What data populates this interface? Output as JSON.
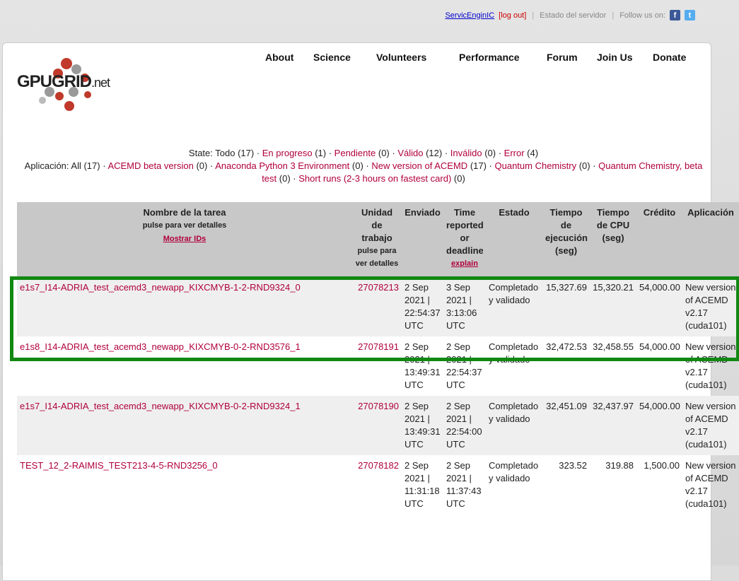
{
  "topbar": {
    "user": "ServicEnginIC",
    "logout": "[log out]",
    "server_status": "Estado del servidor",
    "follow": "Follow us on:",
    "facebook_icon": "f",
    "twitter_icon": "t"
  },
  "logo": {
    "main": "GPUGRID",
    "suffix": ".net"
  },
  "nav": [
    "About",
    "Science",
    "Volunteers",
    "Performance",
    "Forum",
    "Join Us",
    "Donate"
  ],
  "filters": {
    "state_label": "State: Todo (17) ·",
    "states": [
      {
        "label": "En progreso",
        "count": "(1)"
      },
      {
        "label": "Pendiente",
        "count": "(0)"
      },
      {
        "label": "Válido",
        "count": "(12)"
      },
      {
        "label": "Inválido",
        "count": "(0)"
      },
      {
        "label": "Error",
        "count": "(4)"
      }
    ],
    "app_label": "Aplicación: All (17) ·",
    "apps": [
      {
        "label": "ACEMD beta version",
        "count": "(0)"
      },
      {
        "label": "Anaconda Python 3 Environment",
        "count": "(0)"
      },
      {
        "label": "New version of ACEMD",
        "count": "(17)"
      },
      {
        "label": "Quantum Chemistry",
        "count": "(0)"
      },
      {
        "label": "Quantum Chemistry, beta test",
        "count": "(0)"
      },
      {
        "label": "Short runs (2-3 hours on fastest card)",
        "count": "(0)"
      }
    ]
  },
  "table": {
    "headers": {
      "name": "Nombre de la tarea",
      "name_sub": "pulse para ver detalles",
      "name_link": "Mostrar IDs",
      "unit": "Unidad de trabajo",
      "unit_sub": "pulse para ver detalles",
      "sent": "Enviado",
      "time": "Time reported or deadline",
      "time_link": "explain",
      "state": "Estado",
      "runtime": "Tiempo de ejecución (seg)",
      "cputime": "Tiempo de CPU (seg)",
      "credit": "Crédito",
      "app": "Aplicación"
    },
    "rows": [
      {
        "name": "e1s7_I14-ADRIA_test_acemd3_newapp_KIXCMYB-1-2-RND9324_0",
        "unit": "27078213",
        "sent": "2 Sep 2021 | 22:54:37 UTC",
        "time": "3 Sep 2021 | 3:13:06 UTC",
        "state": "Completado y validado",
        "runtime": "15,327.69",
        "cputime": "15,320.21",
        "credit": "54,000.00",
        "app": "New version of ACEMD v2.17 (cuda101)"
      },
      {
        "name": "e1s8_I14-ADRIA_test_acemd3_newapp_KIXCMYB-0-2-RND3576_1",
        "unit": "27078191",
        "sent": "2 Sep 2021 | 13:49:31 UTC",
        "time": "2 Sep 2021 | 22:54:37 UTC",
        "state": "Completado y validado",
        "runtime": "32,472.53",
        "cputime": "32,458.55",
        "credit": "54,000.00",
        "app": "New version of ACEMD v2.17 (cuda101)"
      },
      {
        "name": "e1s7_I14-ADRIA_test_acemd3_newapp_KIXCMYB-0-2-RND9324_1",
        "unit": "27078190",
        "sent": "2 Sep 2021 | 13:49:31 UTC",
        "time": "2 Sep 2021 | 22:54:00 UTC",
        "state": "Completado y validado",
        "runtime": "32,451.09",
        "cputime": "32,437.97",
        "credit": "54,000.00",
        "app": "New version of ACEMD v2.17 (cuda101)"
      },
      {
        "name": "TEST_12_2-RAIMIS_TEST213-4-5-RND3256_0",
        "unit": "27078182",
        "sent": "2 Sep 2021 | 11:31:18 UTC",
        "time": "2 Sep 2021 | 11:37:43 UTC",
        "state": "Completado y validado",
        "runtime": "323.52",
        "cputime": "319.88",
        "credit": "1,500.00",
        "app": "New version of ACEMD v2.17 (cuda101)"
      }
    ]
  },
  "colors": {
    "link": "#b0003a",
    "highlight": "#118811",
    "header_bg": "#c8c8c8",
    "row_alt": "#efefef"
  }
}
